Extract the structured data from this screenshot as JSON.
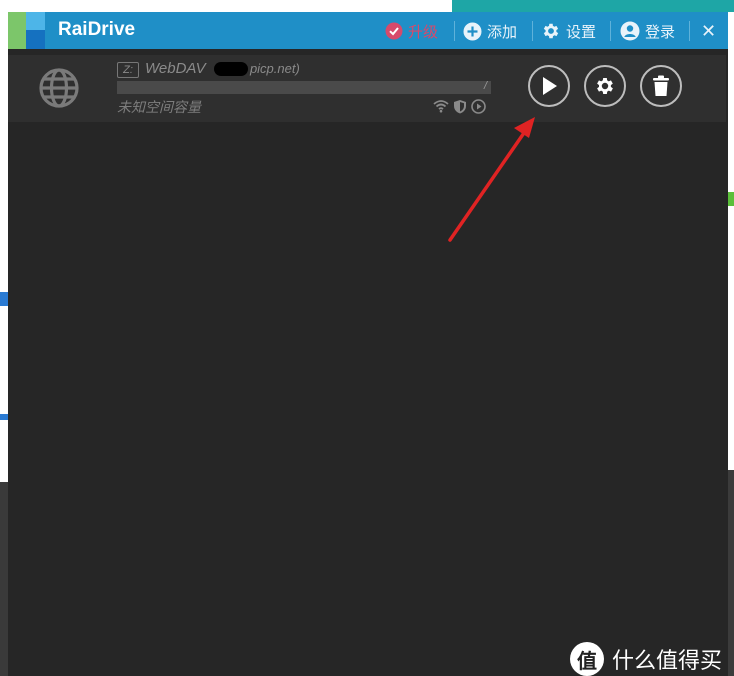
{
  "app": {
    "title": "RaiDrive"
  },
  "toolbar": {
    "upgrade_label": "升级",
    "add_label": "添加",
    "settings_label": "设置",
    "login_label": "登录",
    "close_symbol": "✕"
  },
  "drive": {
    "letter": "Z:",
    "type": "WebDAV",
    "host_suffix": "picp.net)",
    "path": "/",
    "capacity_text": "未知空间容量"
  },
  "colors": {
    "titlebar": "#1f8fc7",
    "window_bg": "#262626",
    "row_bg": "#2f2f2f",
    "upgrade": "#d74a6b",
    "annotation_arrow": "#e02323"
  },
  "icons": {
    "upgrade": "check-badge-icon",
    "add": "plus-circle-icon",
    "settings": "gear-icon",
    "login": "user-icon",
    "drive": "globe-icon",
    "status": [
      "wifi-icon",
      "shield-icon",
      "play-small-icon"
    ],
    "actions": [
      "play-icon",
      "gear-icon",
      "trash-icon"
    ]
  },
  "watermark": {
    "symbol": "值",
    "text": "什么值得买"
  }
}
